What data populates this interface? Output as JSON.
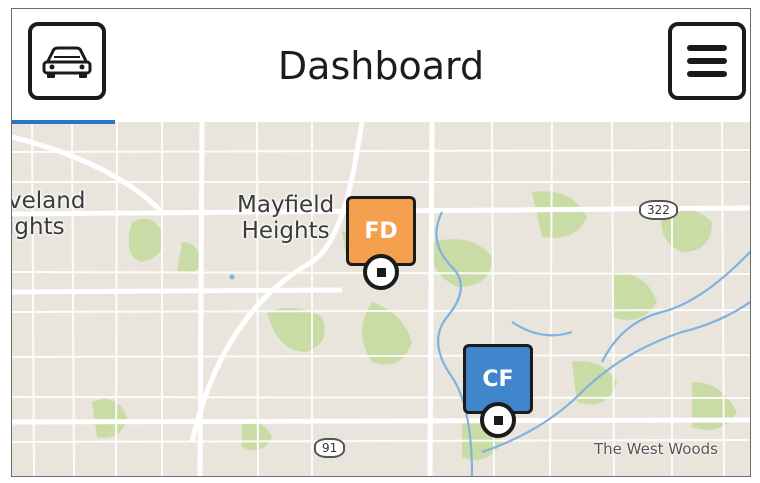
{
  "header": {
    "title": "Dashboard",
    "left_icon": "car-icon",
    "right_icon": "hamburger-menu-icon",
    "progress_fraction": 0.14
  },
  "map": {
    "place_labels": [
      "Cleveland Heights",
      "Mayfield Heights",
      "The West Woods"
    ],
    "cleveland_line1": "veland",
    "cleveland_line2": "ights",
    "mayfield_line1": "Mayfield",
    "mayfield_line2": "Heights",
    "west_woods": "The West Woods",
    "route_shields": [
      "322",
      "91"
    ],
    "markers": [
      {
        "label": "FD",
        "color": "#f5a04f"
      },
      {
        "label": "CF",
        "color": "#3f86cc"
      }
    ]
  },
  "colors": {
    "map_background": "#e9e5dc",
    "park_green": "#c9dca6",
    "road": "#ffffff",
    "water": "#7fb2e0",
    "frame_border": "#6b6b6b"
  }
}
